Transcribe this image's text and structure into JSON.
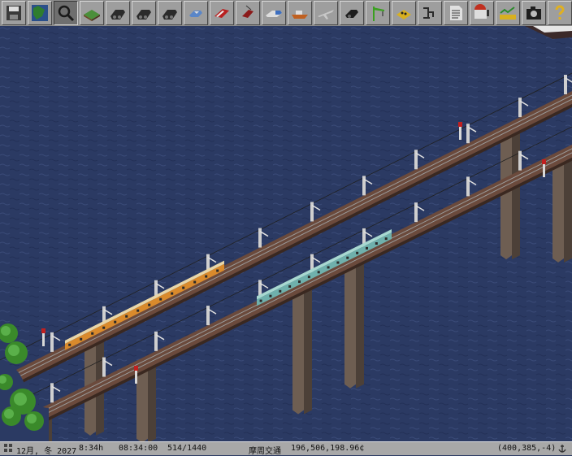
{
  "toolbar": {
    "items": [
      {
        "name": "save-disk-icon",
        "color": "#3a3a3a"
      },
      {
        "name": "minimap-icon",
        "color": "#2e7d2e"
      },
      {
        "name": "zoom-magnifier-icon",
        "color": "#1a1a1a"
      },
      {
        "name": "terrain-icon",
        "color": "#4b8f3a"
      },
      {
        "name": "steam-loco-icon",
        "color": "#2b2b2b"
      },
      {
        "name": "steam-loco-icon",
        "color": "#2b2b2b"
      },
      {
        "name": "steam-loco-icon",
        "color": "#2b2b2b"
      },
      {
        "name": "road-car-icon",
        "color": "#5a86c8"
      },
      {
        "name": "tram-icon",
        "color": "#b82020"
      },
      {
        "name": "trolley-icon",
        "color": "#8b1a1a"
      },
      {
        "name": "truck-icon",
        "color": "#3c6ec0"
      },
      {
        "name": "ship-icon",
        "color": "#c06020"
      },
      {
        "name": "airplane-icon",
        "color": "#c8c8c8"
      },
      {
        "name": "depot-loco-icon",
        "color": "#1e1e1e"
      },
      {
        "name": "crane-icon",
        "color": "#3aa020"
      },
      {
        "name": "industry-gold-icon",
        "color": "#d8b020"
      },
      {
        "name": "transport-network-icon",
        "color": "#2a2a2a"
      },
      {
        "name": "list-document-icon",
        "color": "#e0e0e0"
      },
      {
        "name": "mailbox-icon",
        "color": "#c03020"
      },
      {
        "name": "finance-chart-icon",
        "color": "#d8b020"
      },
      {
        "name": "camera-icon",
        "color": "#1e1e1e"
      },
      {
        "name": "help-question-icon",
        "color": "#e0b020"
      }
    ]
  },
  "colors": {
    "water": "#2b3a63",
    "rail_ballast": "#5a3a2e",
    "rail_bed": "#6b4a3c",
    "pillar": "#6e5e52",
    "pillar_shade": "#4c4038",
    "train_orange": "#d98a2c",
    "train_cream": "#e8d6a8",
    "train_teal": "#6fb0ac",
    "train_teal_light": "#a8d8d0",
    "grass": "#3a8a2a",
    "mast": "#cfcfcf"
  },
  "status": {
    "date": "12月, 冬 2027",
    "time_h": "8:34h",
    "clock": "08:34:00",
    "ratio": "514/1440",
    "company": "摩周交通",
    "funds": "196,506,198.96¢",
    "coords": "(400,385,-4)"
  }
}
